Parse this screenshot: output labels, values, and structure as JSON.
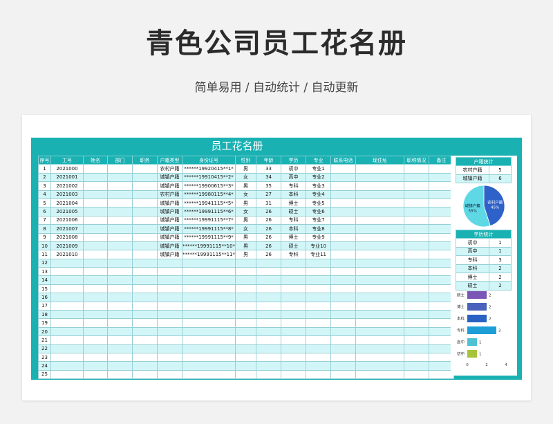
{
  "page": {
    "title": "青色公司员工花名册",
    "subtitle": "简单易用 / 自动统计 / 自动更新"
  },
  "sheet": {
    "title": "员工花名册",
    "headers": [
      "序号",
      "工号",
      "姓名",
      "部门",
      "职务",
      "户籍类型",
      "身份证号",
      "性别",
      "年龄",
      "学历",
      "专业",
      "联系电话",
      "现住址",
      "职称情况",
      "备注"
    ],
    "rows": [
      [
        "1",
        "2021000",
        "",
        "",
        "",
        "农村户籍",
        "******19920415**1*",
        "男",
        "33",
        "初中",
        "专业1",
        "",
        "",
        "",
        ""
      ],
      [
        "2",
        "2021001",
        "",
        "",
        "",
        "城镇户籍",
        "******19910415**2*",
        "女",
        "34",
        "高中",
        "专业2",
        "",
        "",
        "",
        ""
      ],
      [
        "3",
        "2021002",
        "",
        "",
        "",
        "城镇户籍",
        "******19900615**3*",
        "男",
        "35",
        "专科",
        "专业3",
        "",
        "",
        "",
        ""
      ],
      [
        "4",
        "2021003",
        "",
        "",
        "",
        "农村户籍",
        "******19980115**4*",
        "女",
        "27",
        "本科",
        "专业4",
        "",
        "",
        "",
        ""
      ],
      [
        "5",
        "2021004",
        "",
        "",
        "",
        "城镇户籍",
        "******19941115**5*",
        "男",
        "31",
        "博士",
        "专业5",
        "",
        "",
        "",
        ""
      ],
      [
        "6",
        "2021005",
        "",
        "",
        "",
        "城镇户籍",
        "******19991115**6*",
        "女",
        "26",
        "硕士",
        "专业6",
        "",
        "",
        "",
        ""
      ],
      [
        "7",
        "2021006",
        "",
        "",
        "",
        "城镇户籍",
        "******19991115**7*",
        "男",
        "26",
        "专科",
        "专业7",
        "",
        "",
        "",
        ""
      ],
      [
        "8",
        "2021007",
        "",
        "",
        "",
        "城镇户籍",
        "******19991115**8*",
        "女",
        "26",
        "本科",
        "专业8",
        "",
        "",
        "",
        ""
      ],
      [
        "9",
        "2021008",
        "",
        "",
        "",
        "城镇户籍",
        "******19991115**9*",
        "男",
        "26",
        "博士",
        "专业9",
        "",
        "",
        "",
        ""
      ],
      [
        "10",
        "2021009",
        "",
        "",
        "",
        "城镇户籍",
        "******19991115**10*",
        "男",
        "26",
        "硕士",
        "专业10",
        "",
        "",
        "",
        ""
      ],
      [
        "11",
        "2021010",
        "",
        "",
        "",
        "城镇户籍",
        "******19991115**11*",
        "男",
        "26",
        "专科",
        "专业11",
        "",
        "",
        "",
        ""
      ],
      [
        "12",
        "",
        "",
        "",
        "",
        "",
        "",
        "",
        "",
        "",
        "",
        "",
        "",
        "",
        ""
      ],
      [
        "13",
        "",
        "",
        "",
        "",
        "",
        "",
        "",
        "",
        "",
        "",
        "",
        "",
        "",
        ""
      ],
      [
        "14",
        "",
        "",
        "",
        "",
        "",
        "",
        "",
        "",
        "",
        "",
        "",
        "",
        "",
        ""
      ],
      [
        "15",
        "",
        "",
        "",
        "",
        "",
        "",
        "",
        "",
        "",
        "",
        "",
        "",
        "",
        ""
      ],
      [
        "16",
        "",
        "",
        "",
        "",
        "",
        "",
        "",
        "",
        "",
        "",
        "",
        "",
        "",
        ""
      ],
      [
        "17",
        "",
        "",
        "",
        "",
        "",
        "",
        "",
        "",
        "",
        "",
        "",
        "",
        "",
        ""
      ],
      [
        "18",
        "",
        "",
        "",
        "",
        "",
        "",
        "",
        "",
        "",
        "",
        "",
        "",
        "",
        ""
      ],
      [
        "19",
        "",
        "",
        "",
        "",
        "",
        "",
        "",
        "",
        "",
        "",
        "",
        "",
        "",
        ""
      ],
      [
        "20",
        "",
        "",
        "",
        "",
        "",
        "",
        "",
        "",
        "",
        "",
        "",
        "",
        "",
        ""
      ],
      [
        "21",
        "",
        "",
        "",
        "",
        "",
        "",
        "",
        "",
        "",
        "",
        "",
        "",
        "",
        ""
      ],
      [
        "22",
        "",
        "",
        "",
        "",
        "",
        "",
        "",
        "",
        "",
        "",
        "",
        "",
        "",
        ""
      ],
      [
        "23",
        "",
        "",
        "",
        "",
        "",
        "",
        "",
        "",
        "",
        "",
        "",
        "",
        "",
        ""
      ],
      [
        "24",
        "",
        "",
        "",
        "",
        "",
        "",
        "",
        "",
        "",
        "",
        "",
        "",
        "",
        ""
      ],
      [
        "25",
        "",
        "",
        "",
        "",
        "",
        "",
        "",
        "",
        "",
        "",
        "",
        "",
        "",
        ""
      ]
    ]
  },
  "household_stats": {
    "title": "户籍统计",
    "rows": [
      [
        "农村户籍",
        "5"
      ],
      [
        "城镇户籍",
        "6"
      ]
    ]
  },
  "education_stats": {
    "title": "学历统计",
    "rows": [
      [
        "初中",
        "1"
      ],
      [
        "高中",
        "1"
      ],
      [
        "专科",
        "3"
      ],
      [
        "本科",
        "2"
      ],
      [
        "博士",
        "2"
      ],
      [
        "硕士",
        "2"
      ]
    ]
  },
  "chart_data": [
    {
      "type": "pie",
      "labels": [
        "农村户籍",
        "城镇户籍"
      ],
      "values": [
        45,
        55
      ],
      "data_labels": [
        "45%",
        "55%"
      ],
      "colors": [
        "#2f62c8",
        "#5fd8e6"
      ]
    },
    {
      "type": "bar",
      "orientation": "horizontal",
      "categories": [
        "硕士",
        "博士",
        "本科",
        "专科",
        "高中",
        "初中"
      ],
      "values": [
        2,
        2,
        2,
        3,
        1,
        1
      ],
      "xlim": [
        0,
        4
      ],
      "xticks": [
        "0",
        "2",
        "4"
      ],
      "colors": [
        "#7a55b6",
        "#4a62bd",
        "#2a62c4",
        "#1e9ed6",
        "#4cc2d2",
        "#a6c33a"
      ]
    }
  ]
}
